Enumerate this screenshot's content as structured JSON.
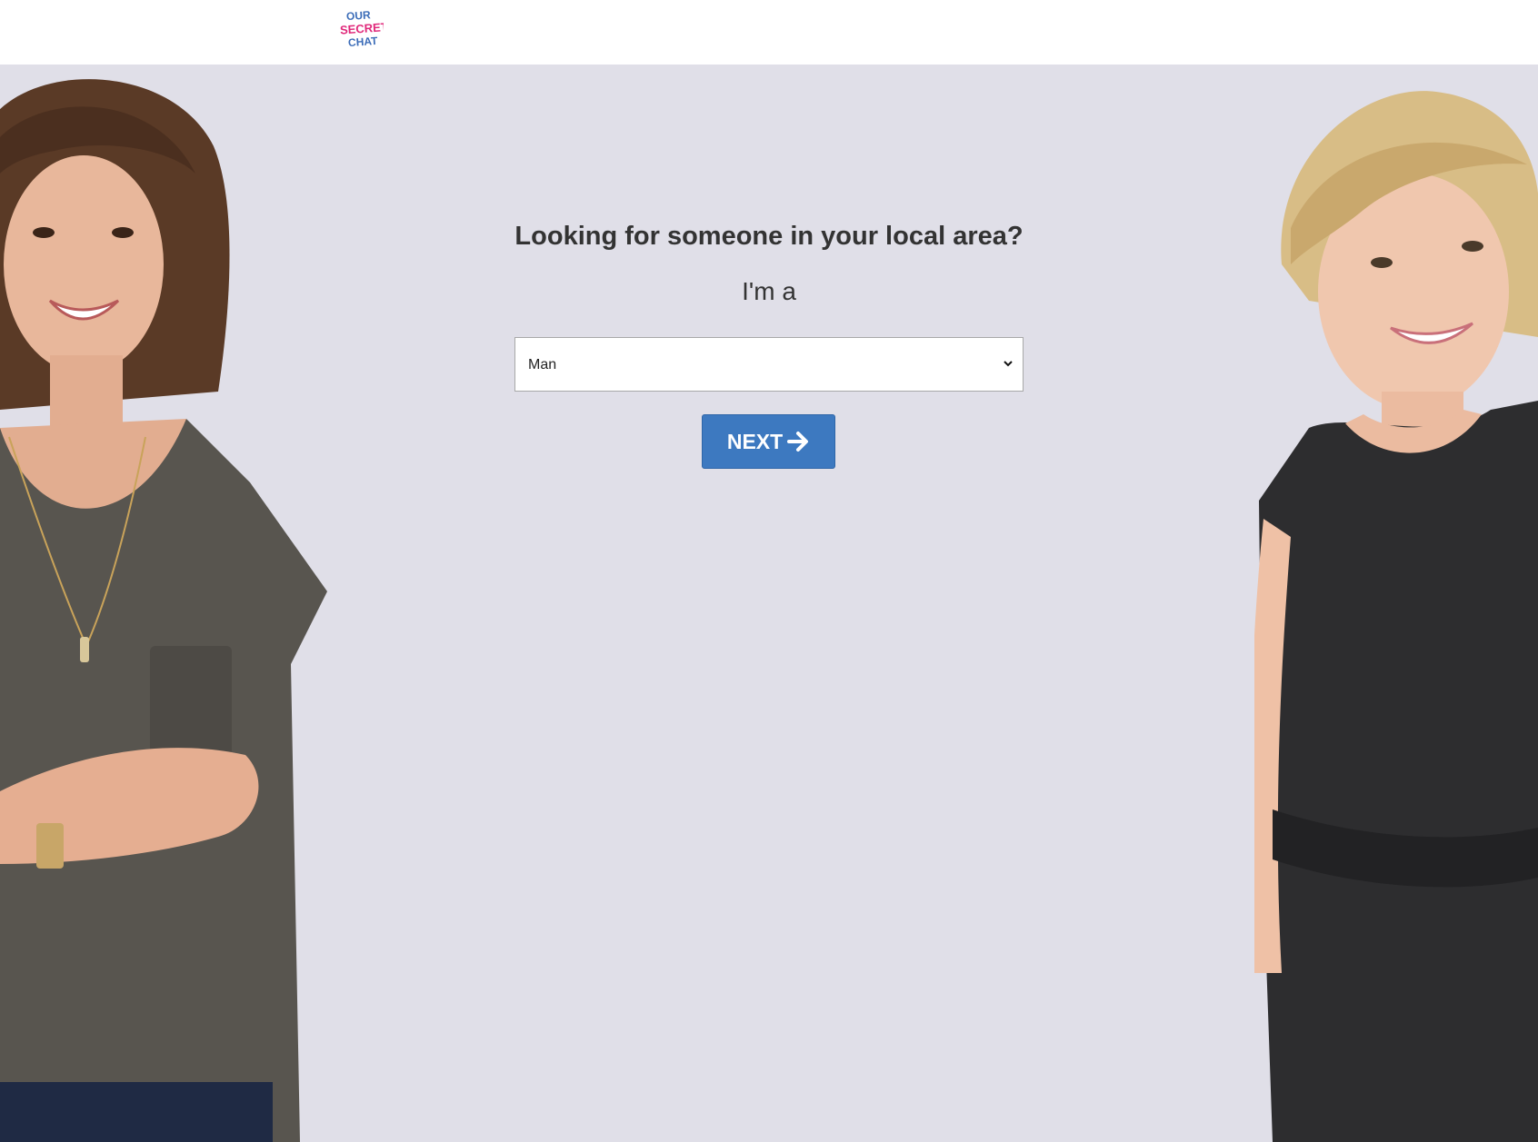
{
  "header": {
    "logo_text_lines": [
      "OUR",
      "SECRET",
      "CHAT"
    ]
  },
  "form": {
    "headline": "Looking for someone in your local area?",
    "subline": "I'm a",
    "gender_select": {
      "selected": "Man",
      "options": [
        "Man"
      ]
    },
    "next_label": "NEXT",
    "next_icon": "arrow-right-icon"
  },
  "colors": {
    "background": "#e0dfe8",
    "button": "#3d79c0",
    "logo_blue": "#3b6cb8",
    "logo_pink": "#e0287a"
  }
}
